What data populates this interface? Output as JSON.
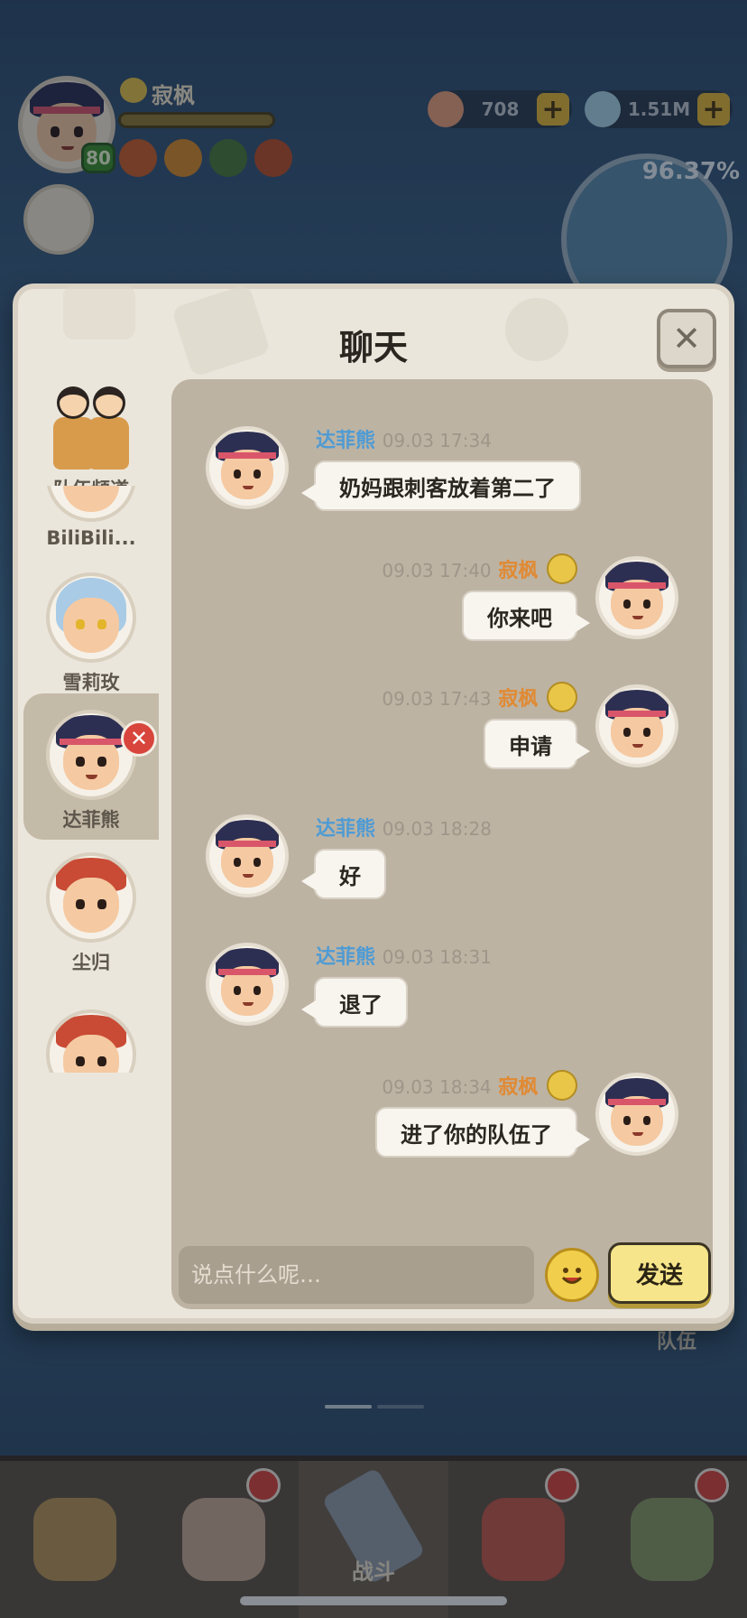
{
  "hud": {
    "player_name": "寂枫",
    "level": "80",
    "resources": [
      {
        "value": "708",
        "icon": "shell-icon"
      },
      {
        "value": "1.51M",
        "icon": "pearl-icon"
      }
    ],
    "map_progress": "96.37%",
    "team_label": "队伍"
  },
  "panel": {
    "title": "聊天",
    "close_icon": "close-icon"
  },
  "channels": [
    {
      "name": "队伍频道",
      "type": "team"
    },
    {
      "name": "BiliBili...",
      "type": "player"
    },
    {
      "name": "雪莉玫",
      "type": "player"
    },
    {
      "name": "达菲熊",
      "type": "player",
      "selected": true
    },
    {
      "name": "尘归",
      "type": "player"
    },
    {
      "name": "",
      "type": "player"
    }
  ],
  "messages": [
    {
      "side": "left",
      "nick": "达菲熊",
      "time": "09.03 17:34",
      "text": "奶妈跟刺客放着第二了"
    },
    {
      "side": "right",
      "nick": "寂枫",
      "time": "09.03 17:40",
      "text": "你来吧"
    },
    {
      "side": "right",
      "nick": "寂枫",
      "time": "09.03 17:43",
      "text": "申请"
    },
    {
      "side": "left",
      "nick": "达菲熊",
      "time": "09.03 18:28",
      "text": "好"
    },
    {
      "side": "left",
      "nick": "达菲熊",
      "time": "09.03 18:31",
      "text": "退了"
    },
    {
      "side": "right",
      "nick": "寂枫",
      "time": "09.03 18:34",
      "text": "进了你的队伍了"
    }
  ],
  "input": {
    "placeholder": "说点什么呢…",
    "value": "",
    "send_label": "发送",
    "emoji_icon": "smiley-icon"
  },
  "bottom_nav": [
    {
      "label": "",
      "icon": "hut-icon"
    },
    {
      "label": "",
      "icon": "hero-icon",
      "alert": true
    },
    {
      "label": "战斗",
      "icon": "battle-sword-icon",
      "active": true
    },
    {
      "label": "",
      "icon": "pet-icon",
      "alert": true
    },
    {
      "label": "",
      "icon": "guild-icon",
      "alert": true
    }
  ]
}
